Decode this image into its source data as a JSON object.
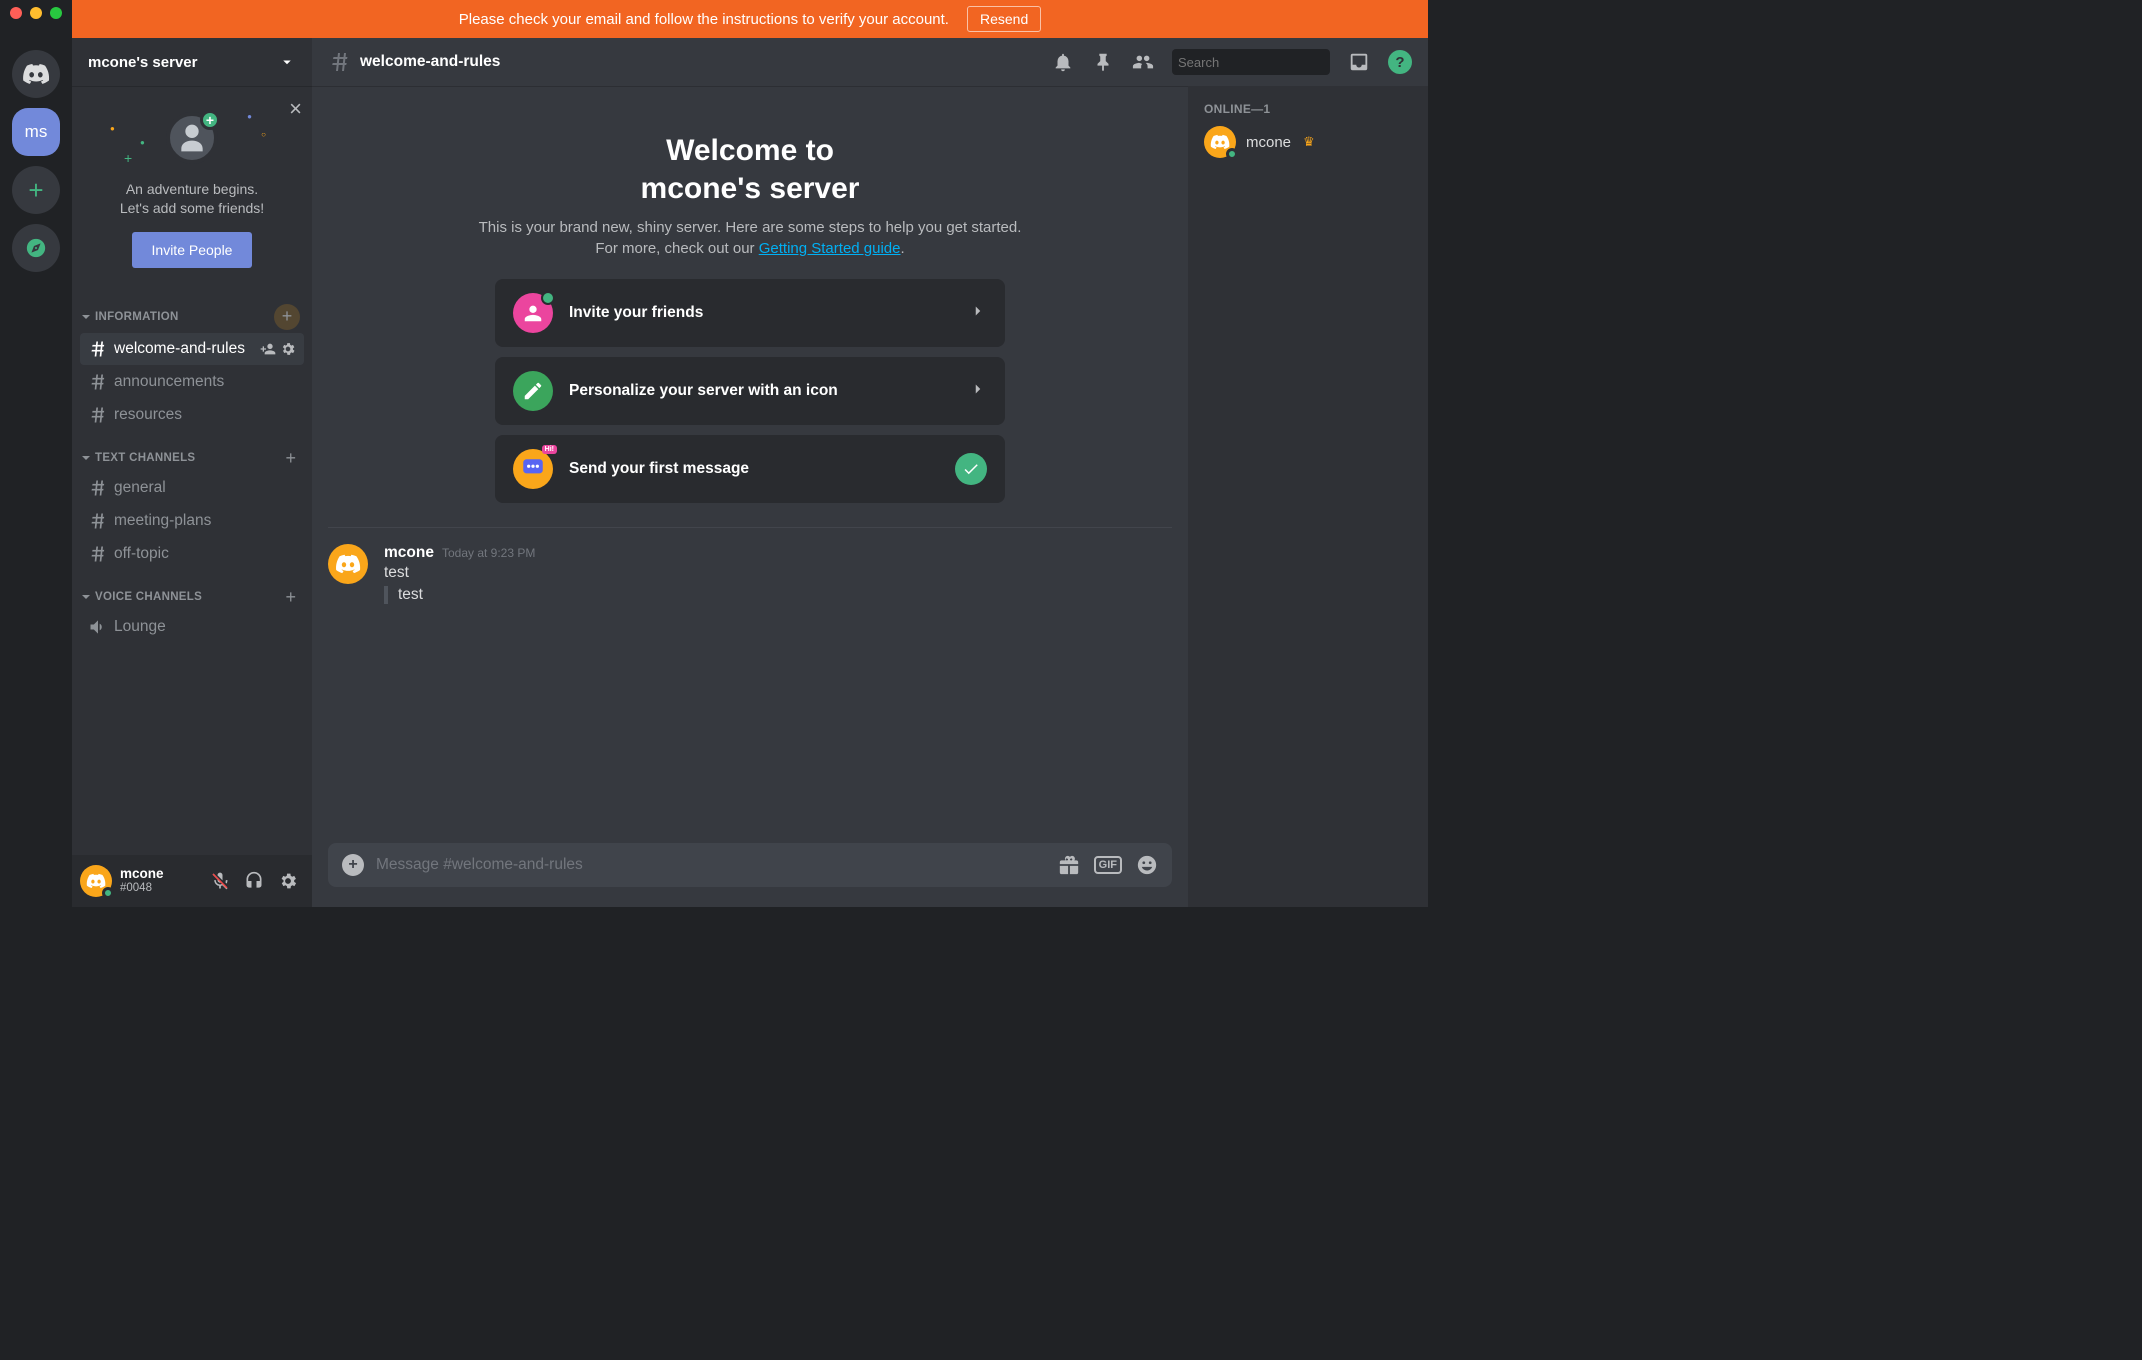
{
  "banner": {
    "text": "Please check your email and follow the instructions to verify your account.",
    "button": "Resend"
  },
  "guilds": {
    "selected_initials": "ms"
  },
  "server": {
    "name": "mcone's server"
  },
  "welcome_card": {
    "line1": "An adventure begins.",
    "line2": "Let's add some friends!",
    "button": "Invite People"
  },
  "categories": [
    {
      "name": "INFORMATION",
      "channels": [
        {
          "name": "welcome-and-rules",
          "type": "text",
          "selected": true
        },
        {
          "name": "announcements",
          "type": "text"
        },
        {
          "name": "resources",
          "type": "text"
        }
      ]
    },
    {
      "name": "TEXT CHANNELS",
      "channels": [
        {
          "name": "general",
          "type": "text"
        },
        {
          "name": "meeting-plans",
          "type": "text"
        },
        {
          "name": "off-topic",
          "type": "text"
        }
      ]
    },
    {
      "name": "VOICE CHANNELS",
      "channels": [
        {
          "name": "Lounge",
          "type": "voice"
        }
      ]
    }
  ],
  "user": {
    "name": "mcone",
    "tag": "#0048"
  },
  "channel_header": {
    "name": "welcome-and-rules",
    "search_placeholder": "Search"
  },
  "welcome_block": {
    "title_line1": "Welcome to",
    "title_line2": "mcone's server",
    "desc_before": "This is your brand new, shiny server. Here are some steps to help you get started. For more, check out our ",
    "link_text": "Getting Started guide",
    "desc_after": "."
  },
  "steps": [
    {
      "label": "Invite your friends",
      "done": false
    },
    {
      "label": "Personalize your server with an icon",
      "done": false
    },
    {
      "label": "Send your first message",
      "done": true
    }
  ],
  "message": {
    "author": "mcone",
    "timestamp": "Today at 9:23 PM",
    "text": "test",
    "quote": "test"
  },
  "composer": {
    "placeholder": "Message #welcome-and-rules"
  },
  "members_header": "ONLINE—1",
  "members": [
    {
      "name": "mcone",
      "owner": true
    }
  ]
}
